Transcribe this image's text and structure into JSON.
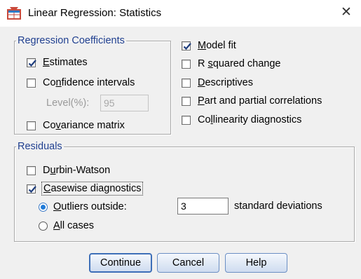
{
  "window": {
    "title": "Linear Regression: Statistics",
    "close_glyph": "✕"
  },
  "regression_coefficients": {
    "legend": "Regression Coefficients",
    "estimates": {
      "label_prefix": "",
      "label_ul": "E",
      "label_rest": "stimates",
      "checked": true
    },
    "confidence_intervals": {
      "label_prefix": "Co",
      "label_ul": "n",
      "label_rest": "fidence intervals",
      "checked": false
    },
    "level_label": "Level(%):",
    "level_value": "95",
    "covariance_matrix": {
      "label_prefix": "Co",
      "label_ul": "v",
      "label_rest": "ariance matrix",
      "checked": false
    }
  },
  "right_options": {
    "model_fit": {
      "label_prefix": "",
      "label_ul": "M",
      "label_rest": "odel fit",
      "checked": true
    },
    "r_squared_change": {
      "label_prefix": "R ",
      "label_ul": "s",
      "label_rest": "quared change",
      "checked": false
    },
    "descriptives": {
      "label_prefix": "",
      "label_ul": "D",
      "label_rest": "escriptives",
      "checked": false
    },
    "part_partial": {
      "label_prefix": "",
      "label_ul": "P",
      "label_rest": "art and partial correlations",
      "checked": false
    },
    "collinearity": {
      "label_prefix": "Co",
      "label_ul": "l",
      "label_rest": "linearity diagnostics",
      "checked": false
    }
  },
  "residuals": {
    "legend": "Residuals",
    "durbin_watson": {
      "label_prefix": "D",
      "label_ul": "u",
      "label_rest": "rbin-Watson",
      "checked": false
    },
    "casewise": {
      "label_prefix": "",
      "label_ul": "C",
      "label_rest": "asewise diagnostics",
      "checked": true
    },
    "outliers_outside": {
      "label_prefix": "",
      "label_ul": "O",
      "label_rest": "utliers outside:",
      "selected": true
    },
    "outliers_value": "3",
    "std_dev_label": "standard deviations",
    "all_cases": {
      "label_prefix": "",
      "label_ul": "A",
      "label_rest": "ll cases",
      "selected": false
    }
  },
  "buttons": {
    "continue": "Continue",
    "cancel": "Cancel",
    "help": "Help"
  },
  "colors": {
    "legend_text": "#1f3f8f",
    "check_mark": "#1d3c7c",
    "radio_dot": "#1f7ad8",
    "button_border": "#6b8fc4"
  }
}
